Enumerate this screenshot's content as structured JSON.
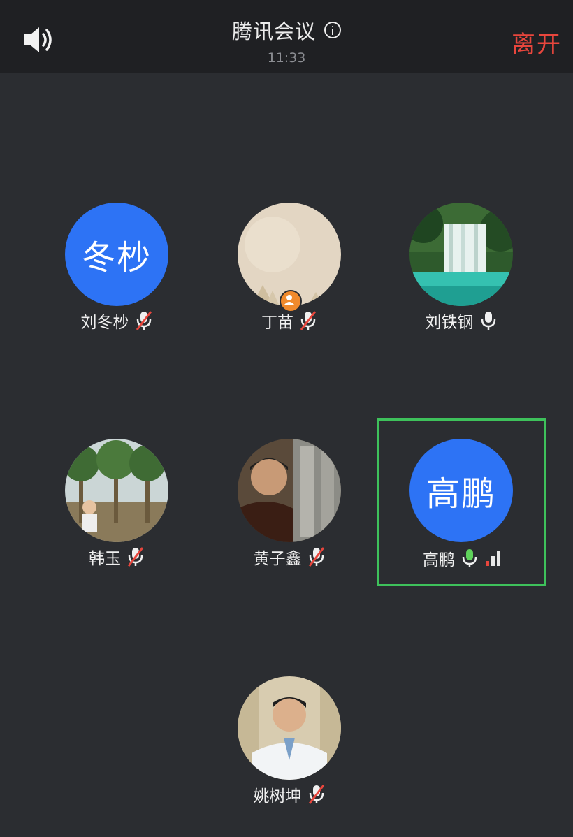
{
  "header": {
    "title": "腾讯会议",
    "time": "11:33",
    "leave_label": "离开",
    "speaker_icon": "speaker-icon",
    "info_icon": "info-icon"
  },
  "participants": [
    {
      "name": "刘冬杪",
      "avatar_text": "冬杪",
      "mic": "muted"
    },
    {
      "name": "丁苗",
      "avatar_text": "",
      "mic": "muted"
    },
    {
      "name": "刘铁钢",
      "avatar_text": "",
      "mic": "on"
    },
    {
      "name": "韩玉",
      "avatar_text": "",
      "mic": "muted"
    },
    {
      "name": "黄子鑫",
      "avatar_text": "",
      "mic": "muted"
    },
    {
      "name": "高鹏",
      "avatar_text": "高鹏",
      "mic": "speaking"
    },
    {
      "name": "姚树坤",
      "avatar_text": "",
      "mic": "muted"
    }
  ],
  "colors": {
    "background": "#2b2d31",
    "topbar": "#1f2023",
    "leave": "#e8463d",
    "avatar_blue": "#2d73f5",
    "active_border": "#3ec15b",
    "mic_muted_slash": "#e8463d",
    "mic_speaking": "#5fd35b"
  }
}
